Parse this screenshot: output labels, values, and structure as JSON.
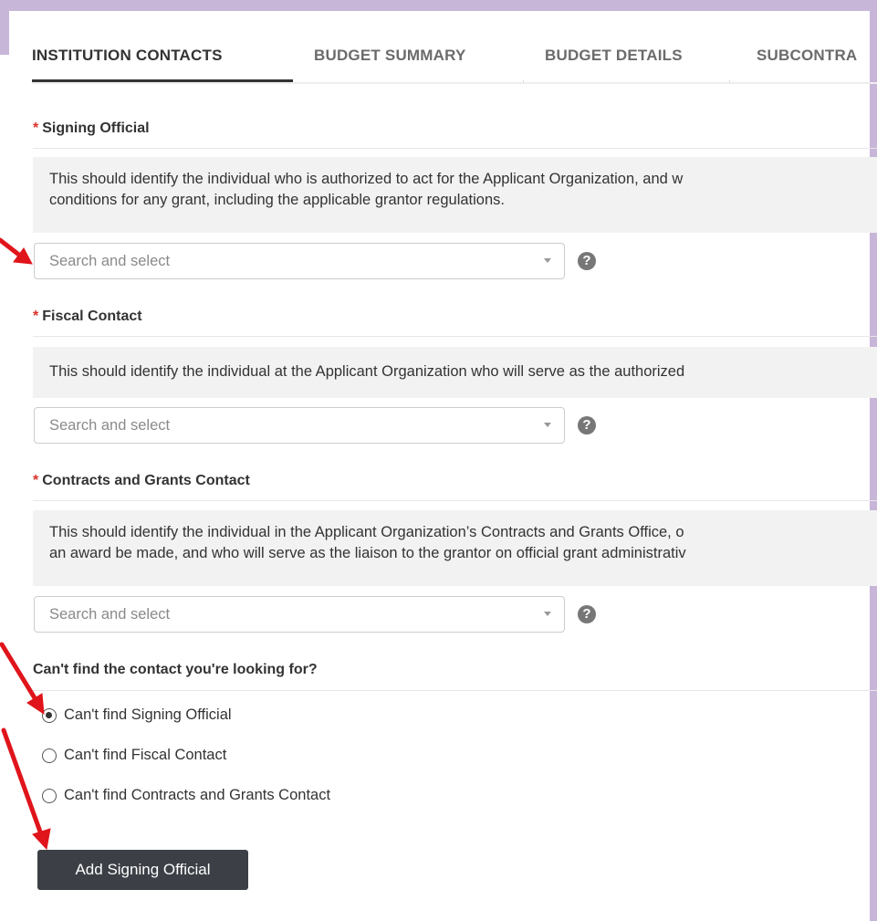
{
  "tabs": [
    {
      "label": "INSTITUTION CONTACTS",
      "active": true
    },
    {
      "label": "BUDGET SUMMARY",
      "active": false
    },
    {
      "label": "BUDGET DETAILS",
      "active": false
    },
    {
      "label": "SUBCONTRA",
      "active": false
    }
  ],
  "sections": {
    "signing_official": {
      "title": "Signing Official",
      "required_mark": "*",
      "description_line1": "This should identify the individual who is authorized to act for the Applicant Organization, and w",
      "description_line2": "conditions for any grant, including the applicable grantor regulations.",
      "placeholder": "Search and select"
    },
    "fiscal_contact": {
      "title": "Fiscal Contact",
      "required_mark": "*",
      "description_line1": "This should identify the individual at the Applicant Organization who will serve as the authorized",
      "placeholder": "Search and select"
    },
    "contracts_grants": {
      "title": "Contracts and Grants Contact",
      "required_mark": "*",
      "description_line1": "This should identify the individual in the Applicant Organization’s Contracts and Grants Office, o",
      "description_line2": "an award be made, and who will serve as the liaison to the grantor on official grant administrativ",
      "placeholder": "Search and select"
    }
  },
  "help_glyph": "?",
  "cant_find": {
    "title": "Can't find the contact you're looking for?",
    "options": [
      {
        "label": "Can't find Signing Official",
        "checked": true
      },
      {
        "label": "Can't find Fiscal Contact",
        "checked": false
      },
      {
        "label": "Can't find Contracts and Grants Contact",
        "checked": false
      }
    ]
  },
  "add_button_label": "Add Signing Official",
  "colors": {
    "frame": "#c7b6d7",
    "required": "#d9312b",
    "annotation_arrow": "#e0141b",
    "button_bg": "#3c4046"
  }
}
